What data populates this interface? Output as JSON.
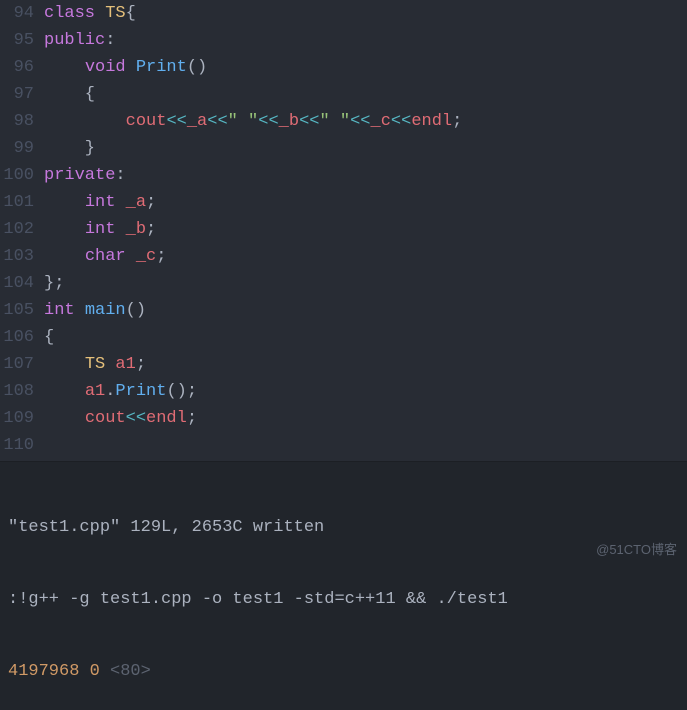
{
  "watermark": "@51CTO博客",
  "gutter": {
    "start": 94,
    "end": 110
  },
  "lines": [
    {
      "ln": 94,
      "tokens": [
        [
          "keyword",
          "class "
        ],
        [
          "class",
          "TS"
        ],
        [
          "punct",
          "{"
        ]
      ]
    },
    {
      "ln": 95,
      "tokens": [
        [
          "keyword",
          "public"
        ],
        [
          "punct",
          ":"
        ]
      ]
    },
    {
      "ln": 96,
      "tokens": [
        [
          "punct",
          "    "
        ],
        [
          "type",
          "void"
        ],
        [
          "punct",
          " "
        ],
        [
          "func",
          "Print"
        ],
        [
          "punct",
          "()"
        ]
      ]
    },
    {
      "ln": 97,
      "tokens": [
        [
          "punct",
          "    {"
        ]
      ]
    },
    {
      "ln": 98,
      "tokens": [
        [
          "punct",
          "        "
        ],
        [
          "ident",
          "cout"
        ],
        [
          "op",
          "<<"
        ],
        [
          "ident",
          "_a"
        ],
        [
          "op",
          "<<"
        ],
        [
          "string",
          "\" \""
        ],
        [
          "op",
          "<<"
        ],
        [
          "ident",
          "_b"
        ],
        [
          "op",
          "<<"
        ],
        [
          "string",
          "\" \""
        ],
        [
          "op",
          "<<"
        ],
        [
          "ident",
          "_c"
        ],
        [
          "op",
          "<<"
        ],
        [
          "ident",
          "endl"
        ],
        [
          "punct",
          ";"
        ]
      ]
    },
    {
      "ln": 99,
      "tokens": [
        [
          "punct",
          "    }"
        ]
      ]
    },
    {
      "ln": 100,
      "tokens": [
        [
          "keyword",
          "private"
        ],
        [
          "punct",
          ":"
        ]
      ]
    },
    {
      "ln": 101,
      "tokens": [
        [
          "punct",
          "    "
        ],
        [
          "int",
          "int"
        ],
        [
          "punct",
          " "
        ],
        [
          "ident",
          "_a"
        ],
        [
          "punct",
          ";"
        ]
      ]
    },
    {
      "ln": 102,
      "tokens": [
        [
          "punct",
          "    "
        ],
        [
          "int",
          "int"
        ],
        [
          "punct",
          " "
        ],
        [
          "ident",
          "_b"
        ],
        [
          "punct",
          ";"
        ]
      ]
    },
    {
      "ln": 103,
      "tokens": [
        [
          "punct",
          "    "
        ],
        [
          "char",
          "char"
        ],
        [
          "punct",
          " "
        ],
        [
          "ident",
          "_c"
        ],
        [
          "punct",
          ";"
        ]
      ]
    },
    {
      "ln": 104,
      "tokens": [
        [
          "punct",
          "};"
        ]
      ]
    },
    {
      "ln": 105,
      "tokens": [
        [
          "punct",
          ""
        ]
      ]
    },
    {
      "ln": 106,
      "tokens": [
        [
          "int",
          "int"
        ],
        [
          "punct",
          " "
        ],
        [
          "func",
          "main"
        ],
        [
          "punct",
          "()"
        ]
      ]
    },
    {
      "ln": 107,
      "tokens": [
        [
          "punct",
          "{"
        ]
      ]
    },
    {
      "ln": 108,
      "tokens": [
        [
          "punct",
          "    "
        ],
        [
          "class",
          "TS"
        ],
        [
          "punct",
          " "
        ],
        [
          "ident",
          "a1"
        ],
        [
          "punct",
          ";"
        ]
      ]
    },
    {
      "ln": 109,
      "tokens": [
        [
          "punct",
          "    "
        ],
        [
          "ident",
          "a1"
        ],
        [
          "punct",
          "."
        ],
        [
          "func",
          "Print"
        ],
        [
          "punct",
          "();"
        ]
      ]
    },
    {
      "ln": 110,
      "tokens": [
        [
          "punct",
          "    "
        ],
        [
          "ident",
          "cout"
        ],
        [
          "op",
          "<<"
        ],
        [
          "ident",
          "endl"
        ],
        [
          "punct",
          ";"
        ]
      ]
    }
  ],
  "footer": {
    "status": "\"test1.cpp\" 129L, 2653C written",
    "command": ":!g++ -g test1.cpp -o test1 -std=c++11 && ./test1",
    "result_prefix": "4197968 0 ",
    "result_angle": "<80>"
  }
}
